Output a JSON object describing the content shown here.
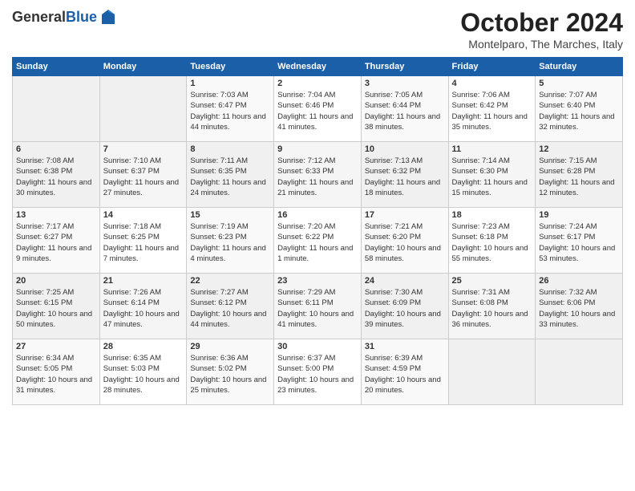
{
  "header": {
    "logo_general": "General",
    "logo_blue": "Blue",
    "month_title": "October 2024",
    "location": "Montelparo, The Marches, Italy"
  },
  "days_of_week": [
    "Sunday",
    "Monday",
    "Tuesday",
    "Wednesday",
    "Thursday",
    "Friday",
    "Saturday"
  ],
  "weeks": [
    [
      {
        "day": "",
        "empty": true
      },
      {
        "day": "",
        "empty": true
      },
      {
        "day": "1",
        "sunrise": "Sunrise: 7:03 AM",
        "sunset": "Sunset: 6:47 PM",
        "daylight": "Daylight: 11 hours and 44 minutes."
      },
      {
        "day": "2",
        "sunrise": "Sunrise: 7:04 AM",
        "sunset": "Sunset: 6:46 PM",
        "daylight": "Daylight: 11 hours and 41 minutes."
      },
      {
        "day": "3",
        "sunrise": "Sunrise: 7:05 AM",
        "sunset": "Sunset: 6:44 PM",
        "daylight": "Daylight: 11 hours and 38 minutes."
      },
      {
        "day": "4",
        "sunrise": "Sunrise: 7:06 AM",
        "sunset": "Sunset: 6:42 PM",
        "daylight": "Daylight: 11 hours and 35 minutes."
      },
      {
        "day": "5",
        "sunrise": "Sunrise: 7:07 AM",
        "sunset": "Sunset: 6:40 PM",
        "daylight": "Daylight: 11 hours and 32 minutes."
      }
    ],
    [
      {
        "day": "6",
        "sunrise": "Sunrise: 7:08 AM",
        "sunset": "Sunset: 6:38 PM",
        "daylight": "Daylight: 11 hours and 30 minutes."
      },
      {
        "day": "7",
        "sunrise": "Sunrise: 7:10 AM",
        "sunset": "Sunset: 6:37 PM",
        "daylight": "Daylight: 11 hours and 27 minutes."
      },
      {
        "day": "8",
        "sunrise": "Sunrise: 7:11 AM",
        "sunset": "Sunset: 6:35 PM",
        "daylight": "Daylight: 11 hours and 24 minutes."
      },
      {
        "day": "9",
        "sunrise": "Sunrise: 7:12 AM",
        "sunset": "Sunset: 6:33 PM",
        "daylight": "Daylight: 11 hours and 21 minutes."
      },
      {
        "day": "10",
        "sunrise": "Sunrise: 7:13 AM",
        "sunset": "Sunset: 6:32 PM",
        "daylight": "Daylight: 11 hours and 18 minutes."
      },
      {
        "day": "11",
        "sunrise": "Sunrise: 7:14 AM",
        "sunset": "Sunset: 6:30 PM",
        "daylight": "Daylight: 11 hours and 15 minutes."
      },
      {
        "day": "12",
        "sunrise": "Sunrise: 7:15 AM",
        "sunset": "Sunset: 6:28 PM",
        "daylight": "Daylight: 11 hours and 12 minutes."
      }
    ],
    [
      {
        "day": "13",
        "sunrise": "Sunrise: 7:17 AM",
        "sunset": "Sunset: 6:27 PM",
        "daylight": "Daylight: 11 hours and 9 minutes."
      },
      {
        "day": "14",
        "sunrise": "Sunrise: 7:18 AM",
        "sunset": "Sunset: 6:25 PM",
        "daylight": "Daylight: 11 hours and 7 minutes."
      },
      {
        "day": "15",
        "sunrise": "Sunrise: 7:19 AM",
        "sunset": "Sunset: 6:23 PM",
        "daylight": "Daylight: 11 hours and 4 minutes."
      },
      {
        "day": "16",
        "sunrise": "Sunrise: 7:20 AM",
        "sunset": "Sunset: 6:22 PM",
        "daylight": "Daylight: 11 hours and 1 minute."
      },
      {
        "day": "17",
        "sunrise": "Sunrise: 7:21 AM",
        "sunset": "Sunset: 6:20 PM",
        "daylight": "Daylight: 10 hours and 58 minutes."
      },
      {
        "day": "18",
        "sunrise": "Sunrise: 7:23 AM",
        "sunset": "Sunset: 6:18 PM",
        "daylight": "Daylight: 10 hours and 55 minutes."
      },
      {
        "day": "19",
        "sunrise": "Sunrise: 7:24 AM",
        "sunset": "Sunset: 6:17 PM",
        "daylight": "Daylight: 10 hours and 53 minutes."
      }
    ],
    [
      {
        "day": "20",
        "sunrise": "Sunrise: 7:25 AM",
        "sunset": "Sunset: 6:15 PM",
        "daylight": "Daylight: 10 hours and 50 minutes."
      },
      {
        "day": "21",
        "sunrise": "Sunrise: 7:26 AM",
        "sunset": "Sunset: 6:14 PM",
        "daylight": "Daylight: 10 hours and 47 minutes."
      },
      {
        "day": "22",
        "sunrise": "Sunrise: 7:27 AM",
        "sunset": "Sunset: 6:12 PM",
        "daylight": "Daylight: 10 hours and 44 minutes."
      },
      {
        "day": "23",
        "sunrise": "Sunrise: 7:29 AM",
        "sunset": "Sunset: 6:11 PM",
        "daylight": "Daylight: 10 hours and 41 minutes."
      },
      {
        "day": "24",
        "sunrise": "Sunrise: 7:30 AM",
        "sunset": "Sunset: 6:09 PM",
        "daylight": "Daylight: 10 hours and 39 minutes."
      },
      {
        "day": "25",
        "sunrise": "Sunrise: 7:31 AM",
        "sunset": "Sunset: 6:08 PM",
        "daylight": "Daylight: 10 hours and 36 minutes."
      },
      {
        "day": "26",
        "sunrise": "Sunrise: 7:32 AM",
        "sunset": "Sunset: 6:06 PM",
        "daylight": "Daylight: 10 hours and 33 minutes."
      }
    ],
    [
      {
        "day": "27",
        "sunrise": "Sunrise: 6:34 AM",
        "sunset": "Sunset: 5:05 PM",
        "daylight": "Daylight: 10 hours and 31 minutes."
      },
      {
        "day": "28",
        "sunrise": "Sunrise: 6:35 AM",
        "sunset": "Sunset: 5:03 PM",
        "daylight": "Daylight: 10 hours and 28 minutes."
      },
      {
        "day": "29",
        "sunrise": "Sunrise: 6:36 AM",
        "sunset": "Sunset: 5:02 PM",
        "daylight": "Daylight: 10 hours and 25 minutes."
      },
      {
        "day": "30",
        "sunrise": "Sunrise: 6:37 AM",
        "sunset": "Sunset: 5:00 PM",
        "daylight": "Daylight: 10 hours and 23 minutes."
      },
      {
        "day": "31",
        "sunrise": "Sunrise: 6:39 AM",
        "sunset": "Sunset: 4:59 PM",
        "daylight": "Daylight: 10 hours and 20 minutes."
      },
      {
        "day": "",
        "empty": true
      },
      {
        "day": "",
        "empty": true
      }
    ]
  ]
}
